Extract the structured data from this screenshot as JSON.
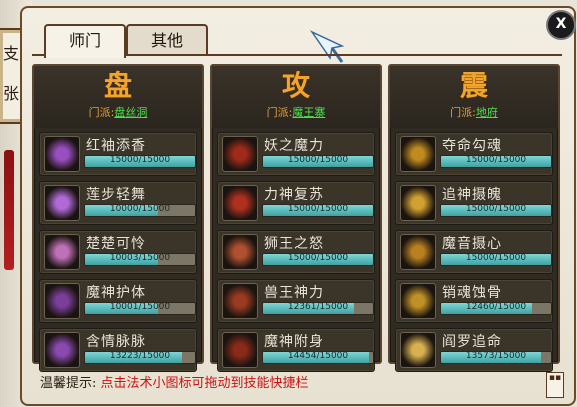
{
  "side_decor": {
    "glyph1": "支",
    "glyph2": "张"
  },
  "window": {
    "close_label": "X",
    "tabs": [
      {
        "label": "师门",
        "active": true
      },
      {
        "label": "其他",
        "active": false
      }
    ]
  },
  "columns": [
    {
      "title": "盘",
      "school_label": "门派:",
      "school_name": "盘丝洞",
      "skills": [
        {
          "name": "红袖添香",
          "progress": "15000/15000",
          "fraction": 1.0,
          "icon": "purple-flower-icon",
          "color": "#9a4fc0"
        },
        {
          "name": "莲步轻舞",
          "progress": "10000/15000",
          "fraction": 0.667,
          "icon": "purple-star-icon",
          "color": "#b06ad8"
        },
        {
          "name": "楚楚可怜",
          "progress": "10003/15000",
          "fraction": 0.667,
          "icon": "pink-petal-icon",
          "color": "#c070b8"
        },
        {
          "name": "魔神护体",
          "progress": "10001/15000",
          "fraction": 0.667,
          "icon": "demon-shield-icon",
          "color": "#7a3f9a"
        },
        {
          "name": "含情脉脉",
          "progress": "13223/15000",
          "fraction": 0.881,
          "icon": "purple-heart-icon",
          "color": "#8a4ab0"
        }
      ]
    },
    {
      "title": "攻",
      "school_label": "门派:",
      "school_name": "魔王寨",
      "skills": [
        {
          "name": "妖之魔力",
          "progress": "15000/15000",
          "fraction": 1.0,
          "icon": "red-demon-icon",
          "color": "#a02a1a"
        },
        {
          "name": "力神复苏",
          "progress": "15000/15000",
          "fraction": 1.0,
          "icon": "red-swirl-icon",
          "color": "#b03020"
        },
        {
          "name": "狮王之怒",
          "progress": "15000/15000",
          "fraction": 1.0,
          "icon": "lion-head-icon",
          "color": "#b05030"
        },
        {
          "name": "兽王神力",
          "progress": "12361/15000",
          "fraction": 0.824,
          "icon": "beast-head-icon",
          "color": "#9a3a20"
        },
        {
          "name": "魔神附身",
          "progress": "14454/15000",
          "fraction": 0.964,
          "icon": "demon-mask-icon",
          "color": "#8a2a18"
        }
      ]
    },
    {
      "title": "震",
      "school_label": "门派:",
      "school_name": "地府",
      "skills": [
        {
          "name": "夺命勾魂",
          "progress": "15000/15000",
          "fraction": 1.0,
          "icon": "golden-hook-icon",
          "color": "#c08a20"
        },
        {
          "name": "追神摄魄",
          "progress": "15000/15000",
          "fraction": 1.0,
          "icon": "golden-spiral-icon",
          "color": "#d0a030"
        },
        {
          "name": "魔音摄心",
          "progress": "15000/15000",
          "fraction": 1.0,
          "icon": "golden-claw-icon",
          "color": "#b88020"
        },
        {
          "name": "销魂蚀骨",
          "progress": "12460/15000",
          "fraction": 0.831,
          "icon": "golden-serpent-icon",
          "color": "#c09028"
        },
        {
          "name": "阎罗追命",
          "progress": "13573/15000",
          "fraction": 0.905,
          "icon": "golden-burst-icon",
          "color": "#d8b050"
        }
      ]
    }
  ],
  "tip": {
    "label": "温馨提示:",
    "text": "点击法术小图标可拖动到技能快捷栏"
  }
}
